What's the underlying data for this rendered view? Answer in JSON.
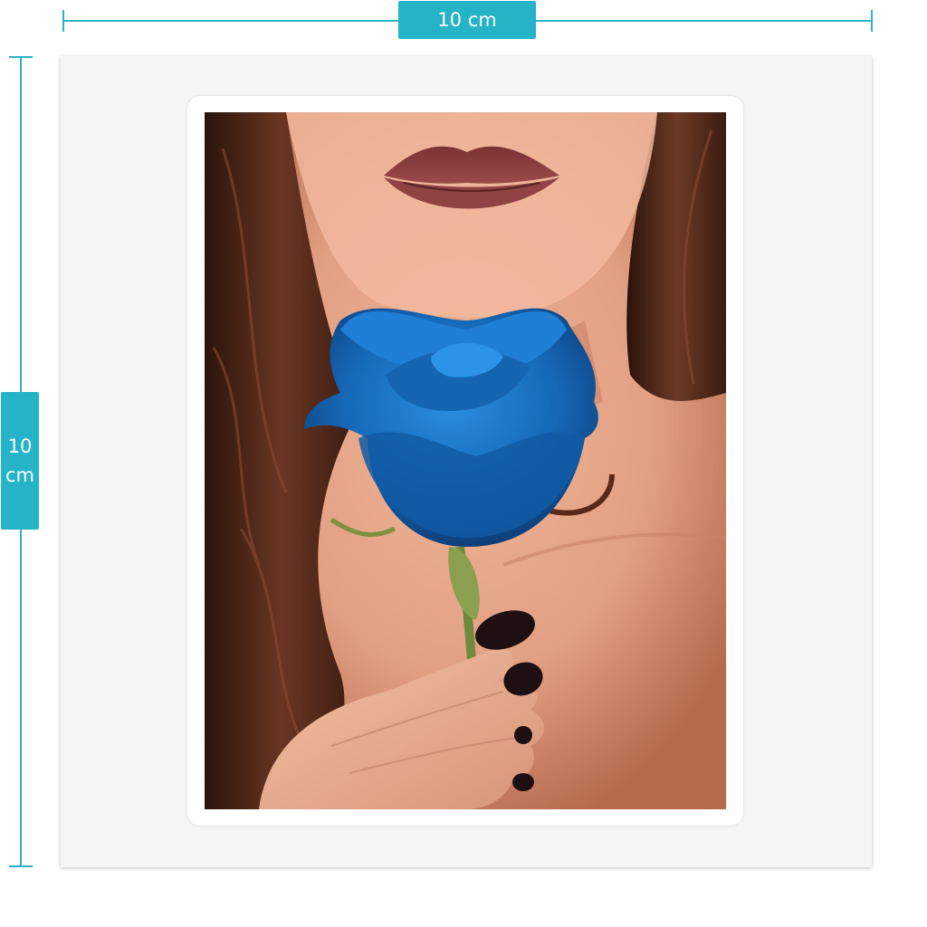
{
  "dimensions": {
    "width_label": "10 cm",
    "height_value": "10",
    "height_unit": "cm"
  },
  "colors": {
    "accent": "#25b3c8",
    "rose": "#1a6fc0",
    "lips": "#8a3d3e",
    "hair": "#5a2e1d",
    "skin": "#e8a98b",
    "nails": "#1e1012"
  },
  "artwork": {
    "subject_icons": [
      "lips-icon",
      "blue-rose-icon",
      "hand-icon"
    ]
  }
}
